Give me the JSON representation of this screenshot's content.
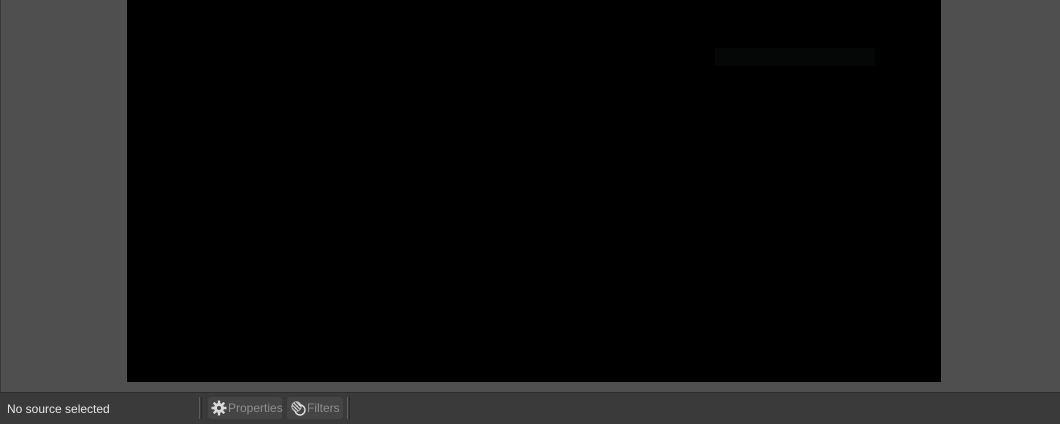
{
  "context_bar": {
    "source_status": "No source selected",
    "properties_label": "Properties",
    "filters_label": "Filters"
  },
  "icons": {
    "properties": "gear-icon",
    "filters": "filter-icon"
  },
  "colors": {
    "panel_background": "#4f4f4f",
    "canvas_background": "#000000",
    "context_bar_background": "#3a3a3a",
    "disabled_text": "#8e8e8e"
  }
}
